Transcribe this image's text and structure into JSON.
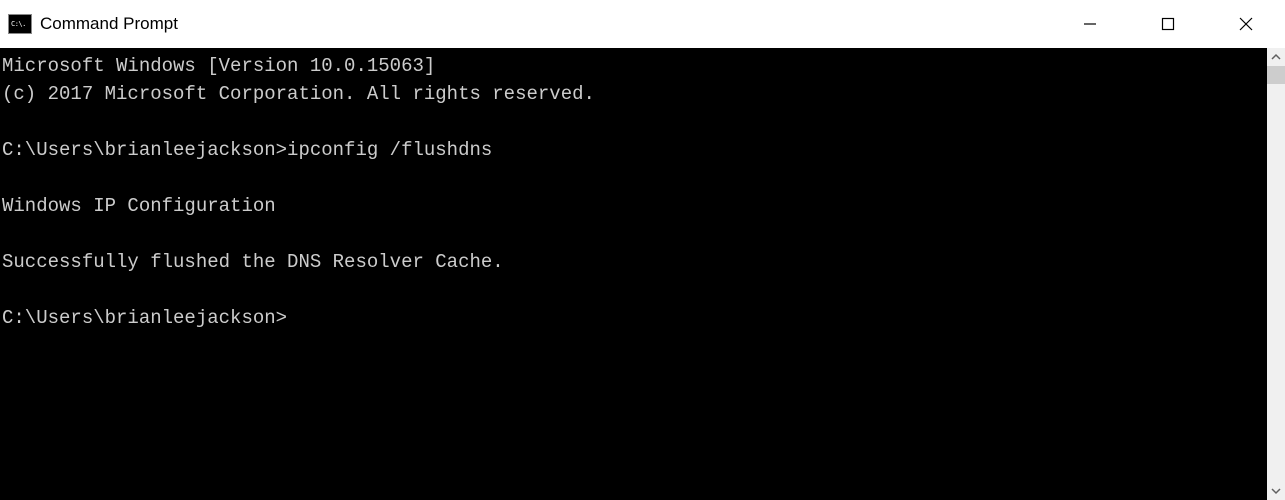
{
  "window": {
    "title": "Command Prompt",
    "icon_text": "C:\\."
  },
  "terminal": {
    "lines": [
      "Microsoft Windows [Version 10.0.15063]",
      "(c) 2017 Microsoft Corporation. All rights reserved.",
      "",
      "C:\\Users\\brianleejackson>ipconfig /flushdns",
      "",
      "Windows IP Configuration",
      "",
      "Successfully flushed the DNS Resolver Cache.",
      "",
      "C:\\Users\\brianleejackson>"
    ]
  }
}
